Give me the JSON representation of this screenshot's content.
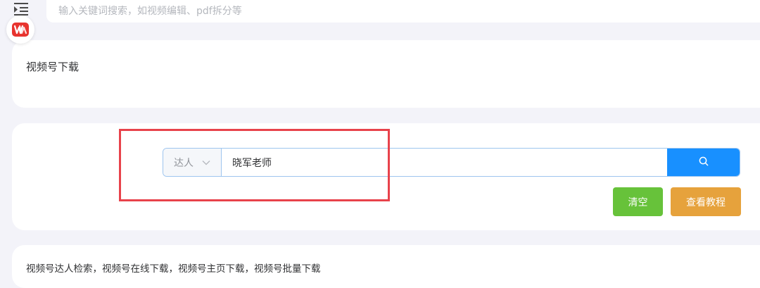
{
  "header": {
    "menu_icon": "menu-indent-icon",
    "search_placeholder": "输入关键词搜索，如视频编辑、pdf拆分等",
    "logo_text": "W",
    "logo_color": "#e8342f"
  },
  "page": {
    "title": "视频号下载"
  },
  "search_form": {
    "type_select": {
      "selected": "达人",
      "icon": "chevron-down-icon"
    },
    "keyword_value": "晓军老师",
    "search_button_icon": "search-icon",
    "clear_label": "清空",
    "tutorial_label": "查看教程"
  },
  "description": {
    "text": "视频号达人检索，视频号在线下载，视频号主页下载，视频号批量下载"
  },
  "colors": {
    "primary": "#1890ff",
    "success": "#67c23a",
    "warning": "#e6a23c",
    "highlight": "#e8424b",
    "background": "#f3f3f9"
  }
}
